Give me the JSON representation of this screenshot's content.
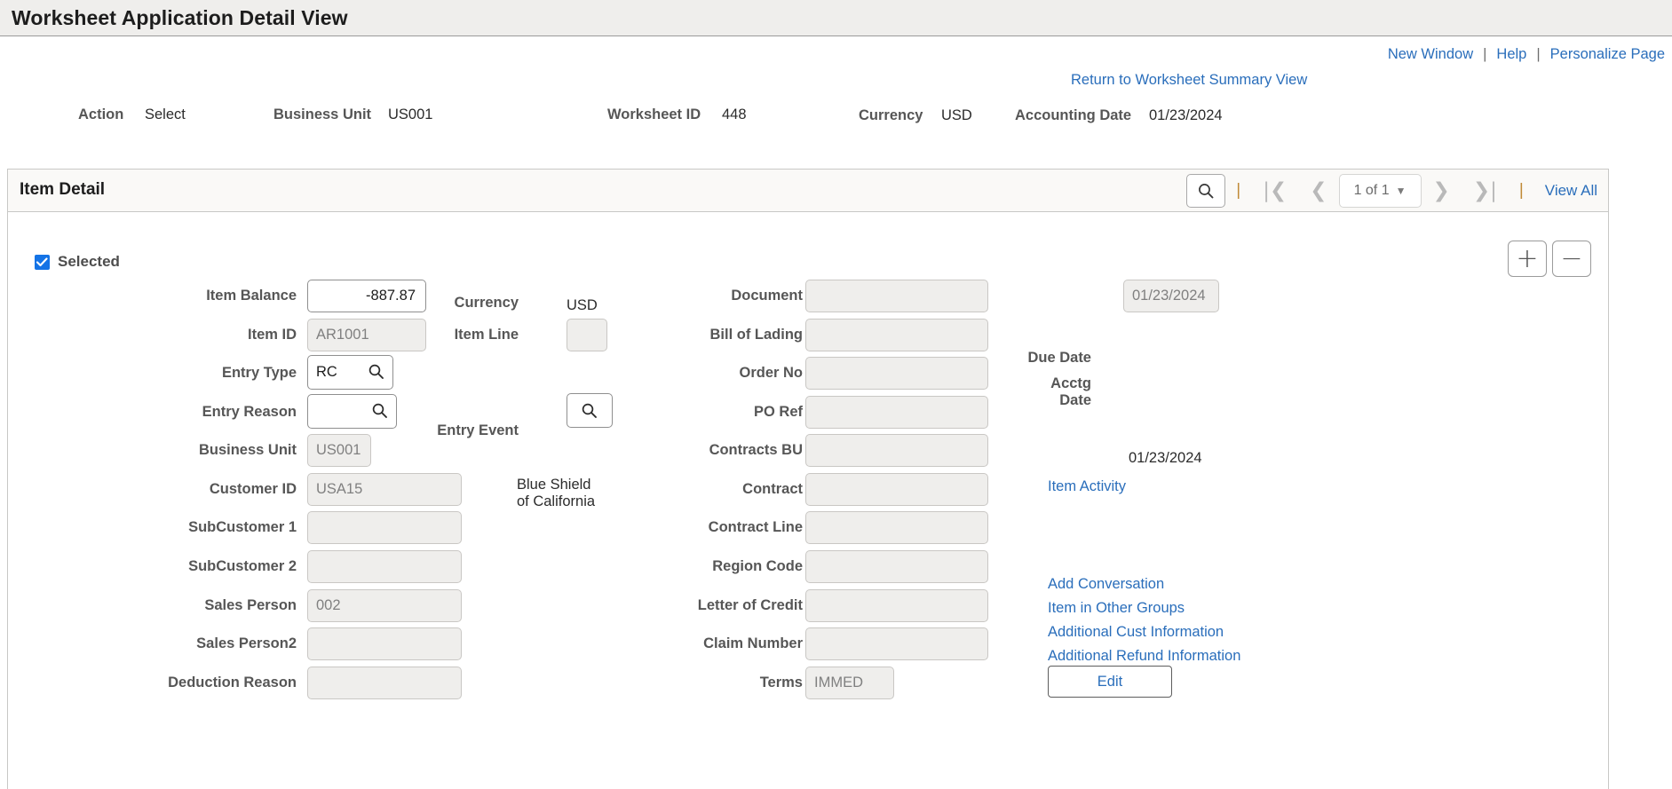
{
  "window": {
    "title": "Worksheet Application Detail View"
  },
  "top_links": {
    "new_window": "New Window",
    "help": "Help",
    "personalize": "Personalize Page",
    "separator": "|"
  },
  "return_link": {
    "label": "Return to Worksheet Summary View"
  },
  "header_facts": [
    {
      "label": "Action",
      "value": "Select"
    },
    {
      "label": "Business Unit",
      "value": "US001"
    },
    {
      "label": "Worksheet ID",
      "value": "448"
    },
    {
      "label": "Currency",
      "value": "USD"
    },
    {
      "label": "Accounting Date",
      "value": "01/23/2024"
    }
  ],
  "item_detail": {
    "title": "Item Detail",
    "pager": {
      "search_icon": "search-icon",
      "first_icon": "first-page-icon",
      "prev_icon": "previous-page-icon",
      "position": "1 of 1",
      "next_icon": "next-page-icon",
      "last_icon": "last-page-icon",
      "view_all": "View All",
      "divider": "|"
    },
    "selected": {
      "label": "Selected",
      "checked": true
    },
    "row_buttons": {
      "add": "+",
      "remove": "−"
    },
    "col1": [
      {
        "label": "Item Balance",
        "value": "-887.87",
        "style": "editable-number"
      },
      {
        "label": "Item ID",
        "value": "AR1001",
        "style": "readonly"
      },
      {
        "label": "Entry Type",
        "value": "RC",
        "style": "lookup"
      },
      {
        "label": "Entry Reason",
        "value": "",
        "style": "lookup"
      },
      {
        "label": "Business Unit",
        "value": "US001",
        "style": "readonly"
      },
      {
        "label": "Customer ID",
        "value": "USA15",
        "style": "readonly"
      },
      {
        "label": "SubCustomer 1",
        "value": "",
        "style": "readonly"
      },
      {
        "label": "SubCustomer 2",
        "value": "",
        "style": "readonly"
      },
      {
        "label": "Sales Person",
        "value": "002",
        "style": "readonly"
      },
      {
        "label": "Sales Person2",
        "value": "",
        "style": "readonly"
      },
      {
        "label": "Deduction Reason",
        "value": "",
        "style": "readonly"
      }
    ],
    "col2": {
      "currency_label": "Currency",
      "currency_value": "USD",
      "item_line_label": "Item Line",
      "item_line_value": "",
      "entry_event_label": "Entry Event",
      "entry_event_value": "",
      "customer_name_line1": "Blue Shield",
      "customer_name_line2": "of California"
    },
    "col3": [
      {
        "label": "Document",
        "value": ""
      },
      {
        "label": "Bill of Lading",
        "value": ""
      },
      {
        "label": "Order No",
        "value": ""
      },
      {
        "label": "PO Ref",
        "value": ""
      },
      {
        "label": "Contracts BU",
        "value": ""
      },
      {
        "label": "Contract",
        "value": ""
      },
      {
        "label": "Contract Line",
        "value": ""
      },
      {
        "label": "Region Code",
        "value": ""
      },
      {
        "label": "Letter of Credit",
        "value": ""
      },
      {
        "label": "Claim Number",
        "value": ""
      },
      {
        "label": "Terms",
        "value": "IMMED"
      }
    ],
    "col4": {
      "date_field": "01/23/2024",
      "due_date_label": "Due Date",
      "acctg_date_label_line1": "Acctg",
      "acctg_date_label_line2": "Date",
      "acctg_date_value": "01/23/2024",
      "item_activity": "Item Activity",
      "links": [
        "Add Conversation",
        "Item in Other Groups",
        "Additional Cust Information",
        "Additional Refund Information"
      ],
      "edit_button": "Edit"
    }
  },
  "colors": {
    "link": "#2a6ebb",
    "label": "#565656",
    "checkbox": "#1473e6",
    "titlebar_bg": "#efeeec",
    "panel_head_bg": "#faf9f7"
  }
}
